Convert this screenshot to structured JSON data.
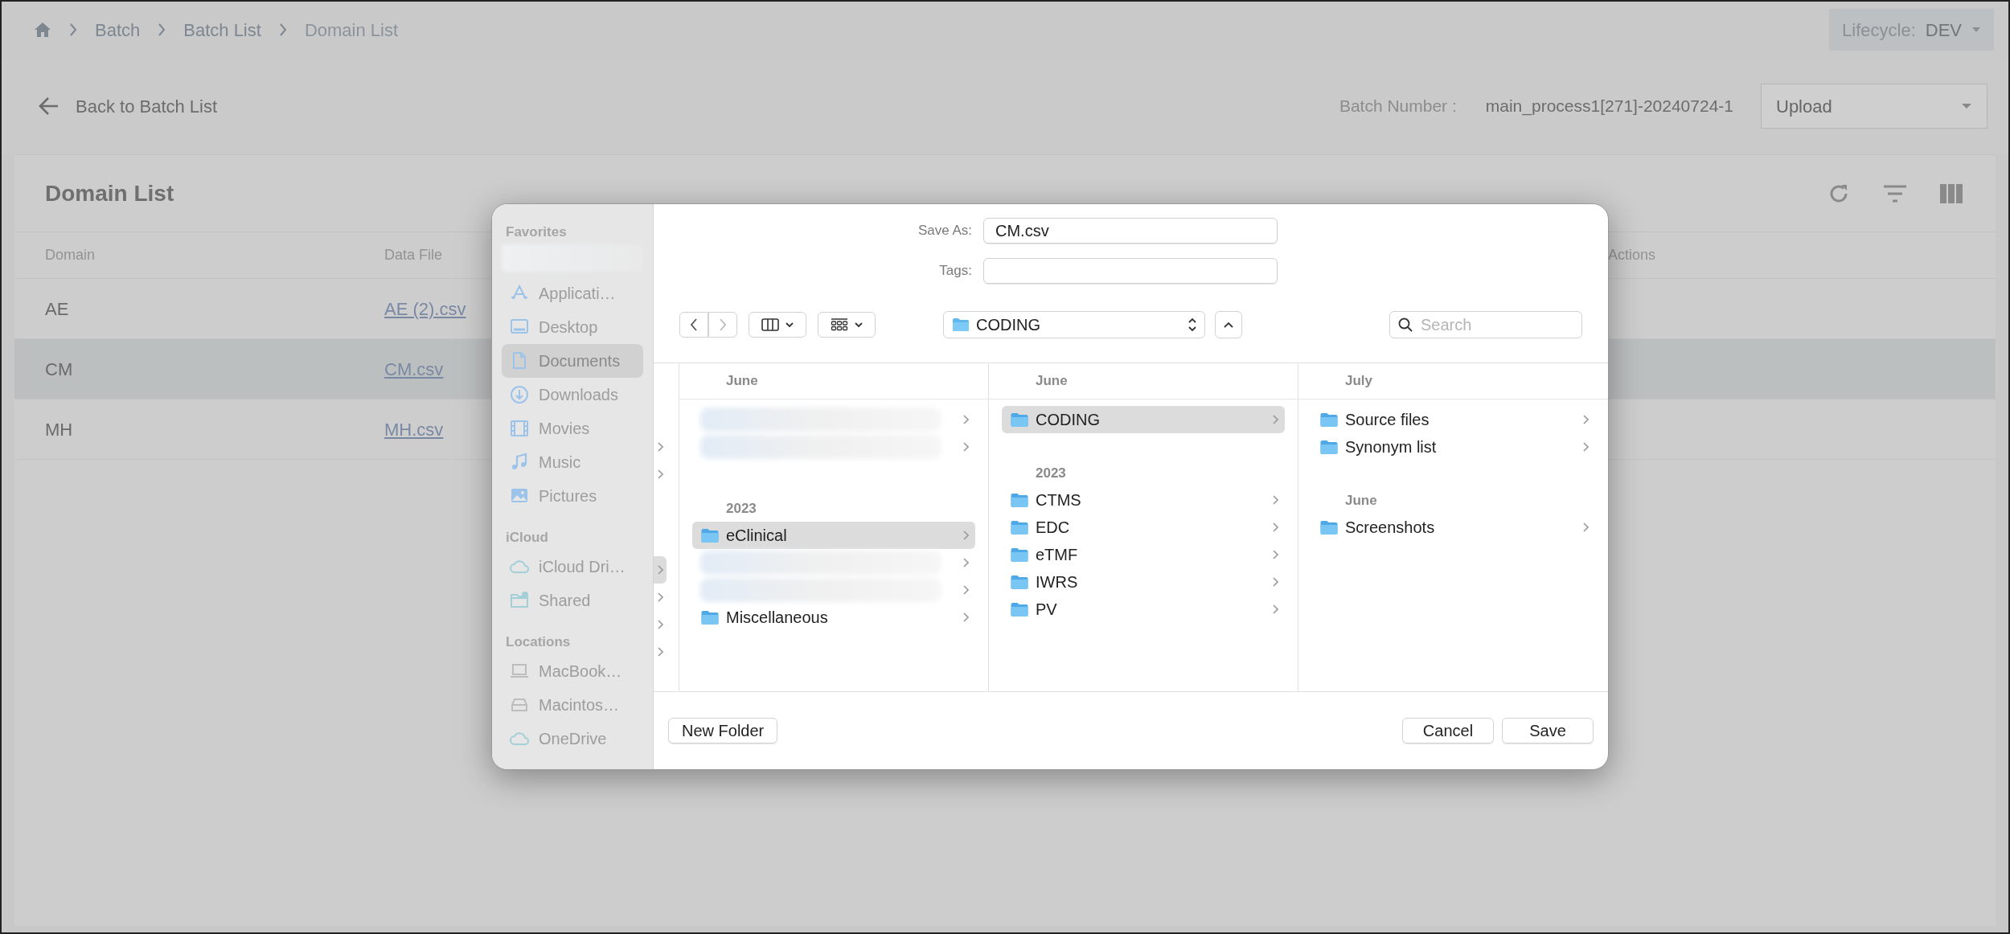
{
  "breadcrumb": [
    "Batch",
    "Batch List",
    "Domain List"
  ],
  "lifecycle": {
    "label": "Lifecycle:",
    "value": "DEV"
  },
  "back_link": "Back to Batch List",
  "batch_number": {
    "label": "Batch Number :",
    "value": "main_process1[271]-20240724-1"
  },
  "action_select": {
    "value": "Upload"
  },
  "panel": {
    "title": "Domain List",
    "columns": [
      "Domain",
      "Data File",
      "Actions"
    ],
    "rows": [
      {
        "domain": "AE",
        "data_file": "AE (2).csv",
        "selected": false
      },
      {
        "domain": "CM",
        "data_file": "CM.csv",
        "selected": true
      },
      {
        "domain": "MH",
        "data_file": "MH.csv",
        "selected": false
      }
    ]
  },
  "dialog": {
    "sidebar": [
      {
        "heading": "Favorites",
        "items": [
          {
            "kind": "blurred"
          },
          {
            "kind": "applications",
            "label": "Applicati…",
            "selected": false
          },
          {
            "kind": "desktop",
            "label": "Desktop",
            "selected": false
          },
          {
            "kind": "documents",
            "label": "Documents",
            "selected": true
          },
          {
            "kind": "downloads",
            "label": "Downloads",
            "selected": false
          },
          {
            "kind": "movies",
            "label": "Movies",
            "selected": false
          },
          {
            "kind": "music",
            "label": "Music",
            "selected": false
          },
          {
            "kind": "pictures",
            "label": "Pictures",
            "selected": false
          }
        ]
      },
      {
        "heading": "iCloud",
        "items": [
          {
            "kind": "cloud",
            "label": "iCloud Dri…",
            "selected": false
          },
          {
            "kind": "shared",
            "label": "Shared",
            "selected": false
          }
        ]
      },
      {
        "heading": "Locations",
        "items": [
          {
            "kind": "laptop",
            "label": "MacBook…",
            "selected": false
          },
          {
            "kind": "disk",
            "label": "Macintos…",
            "selected": false
          },
          {
            "kind": "cloud",
            "label": "OneDrive",
            "selected": false
          }
        ]
      }
    ],
    "save_as": {
      "label": "Save As:",
      "value": "CM.csv"
    },
    "tags": {
      "label": "Tags:"
    },
    "location": "CODING",
    "search": {
      "placeholder": "Search"
    },
    "sliver_rows": [
      {
        "selected": false
      },
      {
        "selected": false
      },
      {
        "selected": true
      },
      {
        "selected": false
      },
      {
        "selected": false
      },
      {
        "selected": false
      }
    ],
    "columns": [
      {
        "header": "June",
        "items": [
          {
            "kind": "blurred",
            "selected": false
          },
          {
            "kind": "blurred",
            "selected": false
          },
          {
            "kind": "section",
            "label": "2023"
          },
          {
            "kind": "folder",
            "label": "eClinical",
            "selected": true
          },
          {
            "kind": "blurred",
            "selected": false
          },
          {
            "kind": "blurred",
            "selected": false
          },
          {
            "kind": "folder",
            "label": "Miscellaneous",
            "selected": false
          }
        ]
      },
      {
        "header": "June",
        "items": [
          {
            "kind": "folder",
            "label": "CODING",
            "selected": true
          },
          {
            "kind": "section",
            "label": "2023"
          },
          {
            "kind": "folder",
            "label": "CTMS",
            "selected": false
          },
          {
            "kind": "folder",
            "label": "EDC",
            "selected": false
          },
          {
            "kind": "folder",
            "label": "eTMF",
            "selected": false
          },
          {
            "kind": "folder",
            "label": "IWRS",
            "selected": false
          },
          {
            "kind": "folder",
            "label": "PV",
            "selected": false
          }
        ]
      },
      {
        "header": "July",
        "items": [
          {
            "kind": "folder",
            "label": "Source files",
            "selected": false
          },
          {
            "kind": "folder",
            "label": "Synonym list",
            "selected": false
          },
          {
            "kind": "section",
            "label": "June"
          },
          {
            "kind": "folder",
            "label": "Screenshots",
            "selected": false
          }
        ]
      }
    ],
    "buttons": {
      "new_folder": "New Folder",
      "cancel": "Cancel",
      "save": "Save"
    }
  }
}
